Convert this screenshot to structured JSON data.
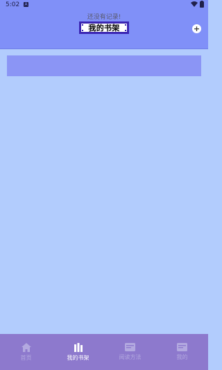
{
  "status_bar": {
    "time": "5:02",
    "notification_glyph": "A"
  },
  "header": {
    "title": "我的书架",
    "add_icon": "plus-circle-icon"
  },
  "bookshelf": {
    "empty_message": "还没有记录!"
  },
  "tabbar": {
    "tabs": [
      {
        "label": "首页",
        "icon": "home-icon",
        "active": false
      },
      {
        "label": "我的书架",
        "icon": "bookshelf-icon",
        "active": true
      },
      {
        "label": "阅读方法",
        "icon": "reading-method-icon",
        "active": false
      },
      {
        "label": "我的",
        "icon": "profile-icon",
        "active": false
      }
    ]
  },
  "colors": {
    "header_bg": "#8090f8",
    "page_bg": "#b2ccfd",
    "tabbar_bg": "#8d79cd",
    "title_border": "#3b26b3"
  }
}
